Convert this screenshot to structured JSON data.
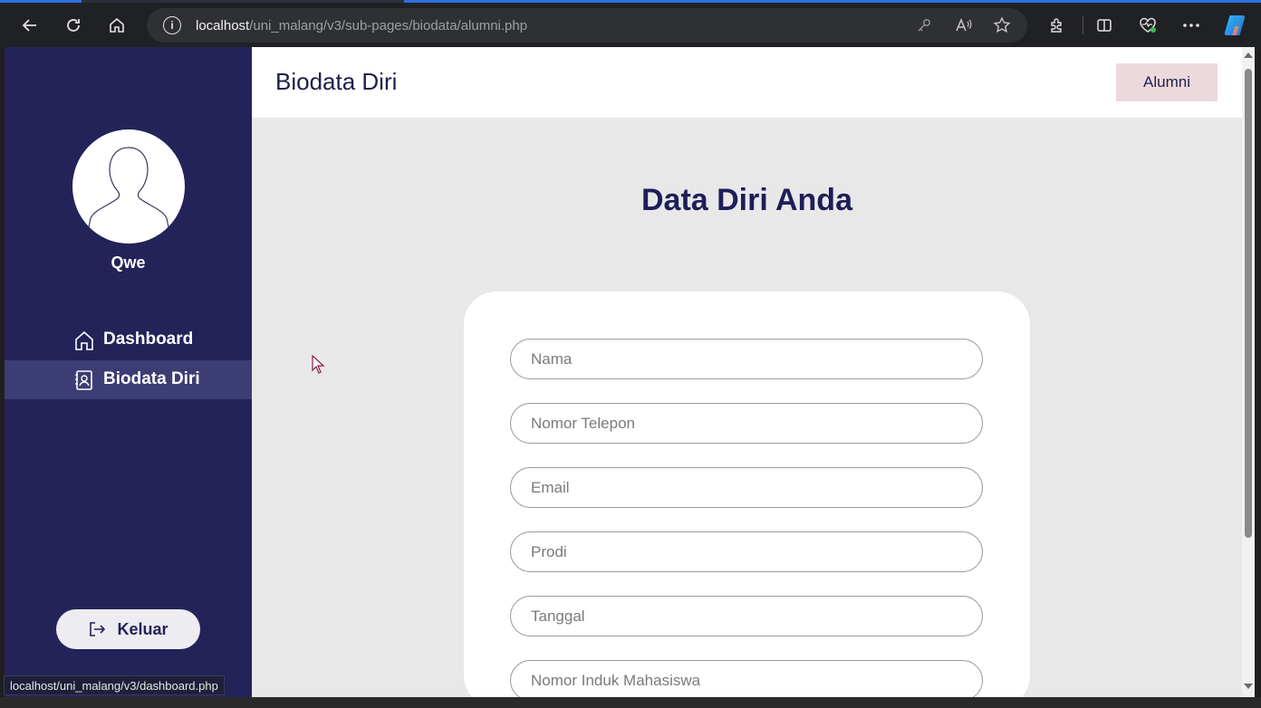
{
  "browser": {
    "url_host": "localhost",
    "url_path": "/uni_malang/v3/sub-pages/biodata/alumni.php",
    "status_url": "localhost/uni_malang/v3/dashboard.php",
    "icons": [
      "back-icon",
      "refresh-icon",
      "home-icon",
      "info-icon",
      "key-icon",
      "read-aloud-icon",
      "favorite-star-icon",
      "extensions-icon",
      "split-screen-icon",
      "health-icon",
      "more-icon",
      "copilot-icon"
    ]
  },
  "sidebar": {
    "username": "Qwe",
    "items": [
      {
        "label": "Dashboard",
        "icon": "home-icon",
        "active": false
      },
      {
        "label": "Biodata Diri",
        "icon": "contact-book-icon",
        "active": true
      }
    ],
    "logout_label": "Keluar"
  },
  "header": {
    "title": "Biodata Diri",
    "role": "Alumni"
  },
  "main": {
    "heading": "Data Diri Anda",
    "fields": [
      {
        "placeholder": "Nama"
      },
      {
        "placeholder": "Nomor Telepon"
      },
      {
        "placeholder": "Email"
      },
      {
        "placeholder": "Prodi"
      },
      {
        "placeholder": "Tanggal"
      },
      {
        "placeholder": "Nomor Induk Mahasiswa"
      }
    ]
  },
  "colors": {
    "sidebar_bg": "#23235a",
    "sidebar_active": "#3d3d75",
    "heading": "#1e1e5a",
    "badge_bg": "#ecd9dd",
    "content_bg": "#e8e8e8"
  }
}
